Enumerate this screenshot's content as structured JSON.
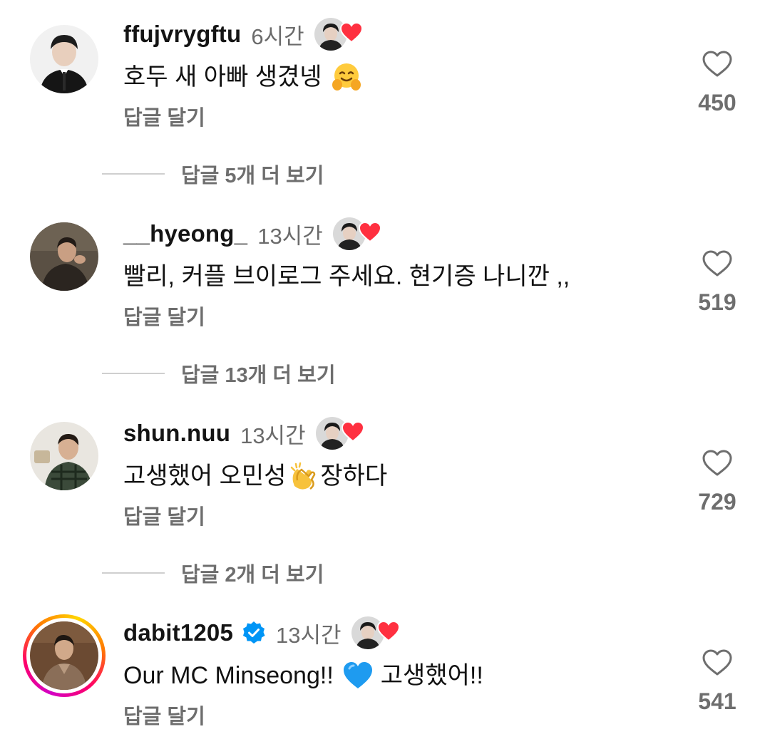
{
  "comments": [
    {
      "username": "ffujvrygftu",
      "time": "6시간",
      "verified": false,
      "text": "호두 새 아빠 생겼넹",
      "emoji": "hugging-face",
      "reply_label": "답글 달기",
      "likes": "450",
      "more_replies": "답글 5개 더 보기"
    },
    {
      "username": "__hyeong_",
      "time": "13시간",
      "verified": false,
      "text": "빨리, 커플 브이로그 주세요. 현기증 나니깐 ,,",
      "reply_label": "답글 달기",
      "likes": "519",
      "more_replies": "답글 13개 더 보기"
    },
    {
      "username": "shun.nuu",
      "time": "13시간",
      "verified": false,
      "text_before": "고생했어 오민성",
      "emoji": "clapping-hands",
      "text_after": "장하다",
      "reply_label": "답글 달기",
      "likes": "729",
      "more_replies": "답글 2개 더 보기"
    },
    {
      "username": "dabit1205",
      "time": "13시간",
      "verified": true,
      "text_before": "Our MC Minseong!!",
      "emoji": "blue-heart",
      "text_after": "고생했어!!",
      "reply_label": "답글 달기",
      "likes": "541",
      "has_story_ring": true
    }
  ],
  "icons": {
    "like": "heart-outline-icon",
    "creator_like": "creator-liked-heart-icon",
    "verified": "verified-badge-icon"
  },
  "colors": {
    "username": "#141414",
    "secondary_text": "#6e6e6e",
    "heart_red": "#ff3040",
    "verified_blue": "#0095f6",
    "divider": "#cfcfcf"
  }
}
